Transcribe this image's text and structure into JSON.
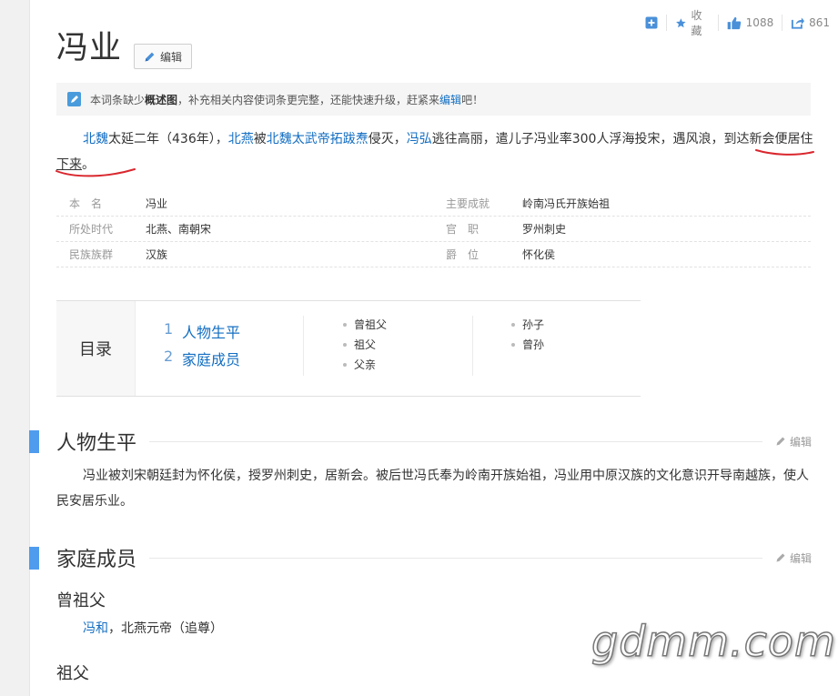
{
  "toolbar": {
    "add_label": "",
    "favorite_label": "收藏",
    "like_count": "1088",
    "share_count": "861"
  },
  "title": "冯业",
  "edit_button_label": "编辑",
  "notice": {
    "pre": "本词条缺少",
    "bold": "概述图",
    "mid": "，补充相关内容使词条更完整，还能快速升级，赶紧来",
    "link": "编辑",
    "post": "吧！"
  },
  "summary": {
    "s1": "北魏",
    "s2": "太延二年（436年），",
    "s3": "北燕",
    "s4": "被",
    "s5": "北魏太武帝拓跋焘",
    "s6": "侵灭，",
    "s7": "冯弘",
    "s8": "逃往高丽，遣儿子冯业率300人浮海投宋，遇风浪，",
    "s9": "到达新会",
    "s10": "便居住",
    "s11": "下来",
    "s12": "。"
  },
  "basic_info": [
    {
      "left_key": "本　名",
      "left_val": "冯业",
      "right_key": "主要成就",
      "right_val": "岭南冯氏开族始祖"
    },
    {
      "left_key": "所处时代",
      "left_val": "北燕、南朝宋",
      "right_key": "官　职",
      "right_val": "罗州刺史"
    },
    {
      "left_key": "民族族群",
      "left_val": "汉族",
      "right_key": "爵　位",
      "right_val": "怀化侯"
    }
  ],
  "catalog": {
    "heading": "目录",
    "level1": [
      {
        "num": "1",
        "label": "人物生平"
      },
      {
        "num": "2",
        "label": "家庭成员"
      }
    ],
    "level2_col1": [
      "曾祖父",
      "祖父",
      "父亲"
    ],
    "level2_col2": [
      "孙子",
      "曾孙"
    ]
  },
  "section1": {
    "heading": "人物生平",
    "edit_label": "编辑",
    "paragraph": "冯业被刘宋朝廷封为怀化侯，授罗州刺史，居新会。被后世冯氏奉为岭南开族始祖，冯业用中原汉族的文化意识开导南越族，使人民安居乐业。"
  },
  "section2": {
    "heading": "家庭成员",
    "edit_label": "编辑",
    "sub1": "曾祖父",
    "sub1_link": "冯和",
    "sub1_text": "，北燕元帝（追尊）",
    "sub2": "祖父"
  },
  "watermark": "gdmm.com",
  "colors": {
    "link": "#136ec2",
    "accent_bar": "#4f9cee",
    "annotation": "#d9272e"
  }
}
